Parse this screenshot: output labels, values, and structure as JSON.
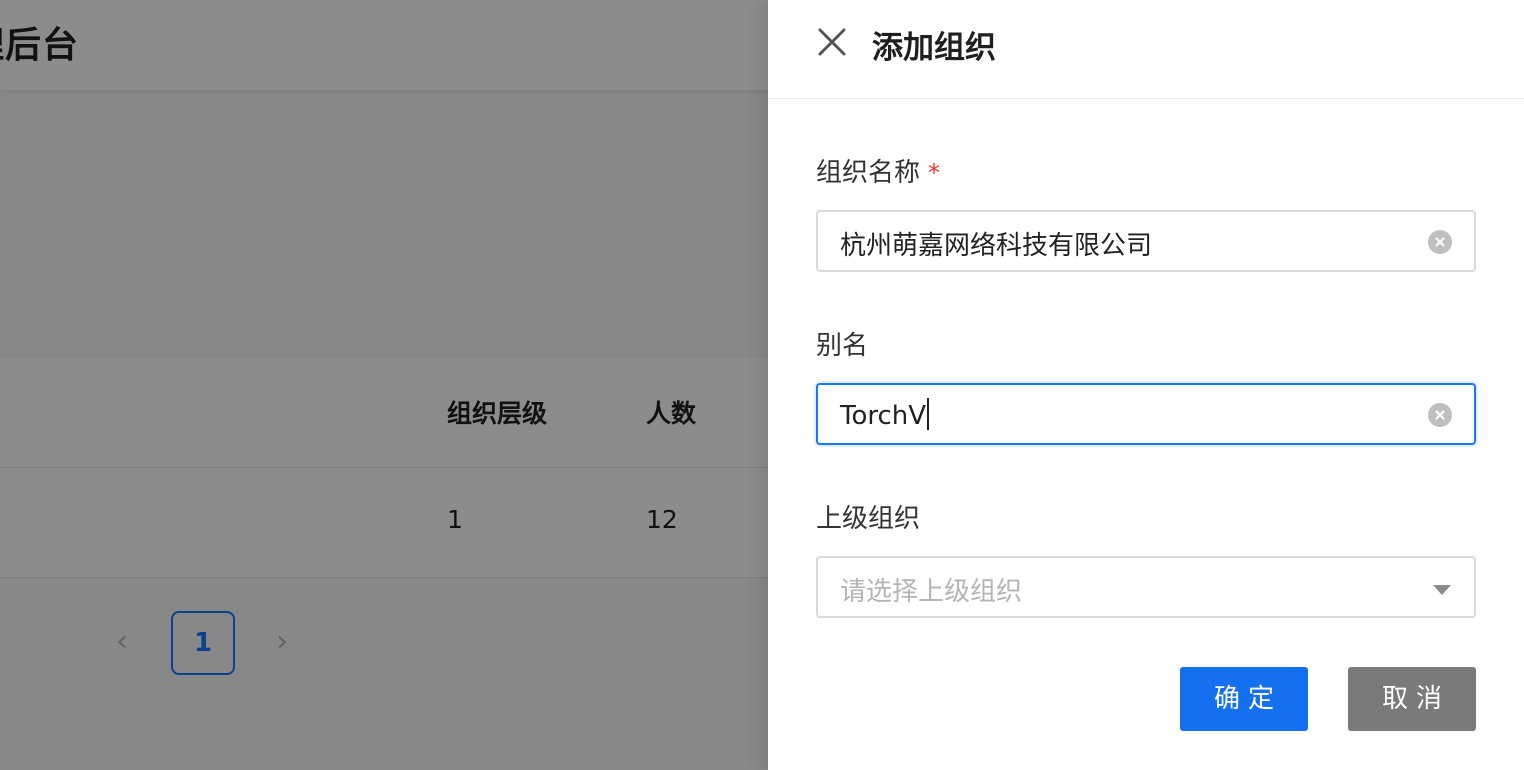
{
  "background": {
    "title": "理后台",
    "table": {
      "columns": [
        "组织层级",
        "人数"
      ],
      "rows": [
        [
          "1",
          "12"
        ]
      ]
    },
    "pagination": {
      "prev": "‹",
      "current_page": "1",
      "next": "›"
    }
  },
  "drawer": {
    "title": "添加组织",
    "close_icon": "close-icon",
    "fields": {
      "org_name": {
        "label": "组织名称",
        "required_mark": "*",
        "value": "杭州萌嘉网络科技有限公司"
      },
      "alias": {
        "label": "别名",
        "value": "TorchV"
      },
      "parent_org": {
        "label": "上级组织",
        "placeholder": "请选择上级组织",
        "value": ""
      }
    },
    "buttons": {
      "confirm": "确定",
      "cancel": "取消"
    }
  },
  "colors": {
    "primary": "#1570ef",
    "cancel": "#7a7a7a",
    "required": "#e53935",
    "focus_border": "#1677ff"
  }
}
